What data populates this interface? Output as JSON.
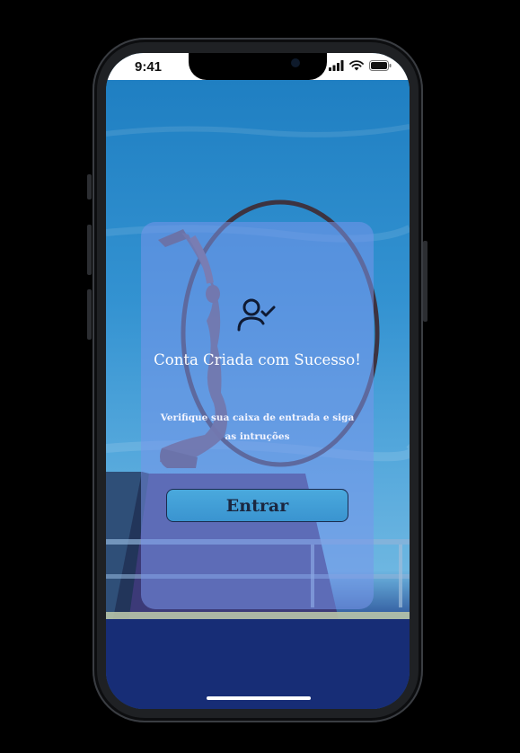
{
  "status_bar": {
    "time": "9:41",
    "icons": [
      "signal-icon",
      "wifi-icon",
      "battery-icon"
    ]
  },
  "card": {
    "icon": "user-check-icon",
    "title": "Conta Criada com Sucesso!",
    "subtitle": "Verifique sua caixa de entrada e siga as intruções",
    "button_label": "Entrar"
  },
  "colors": {
    "card_bg": "#7896eb",
    "button_bg": "#3a94d0",
    "button_text": "#1b2740",
    "title_text": "#ffffff"
  }
}
